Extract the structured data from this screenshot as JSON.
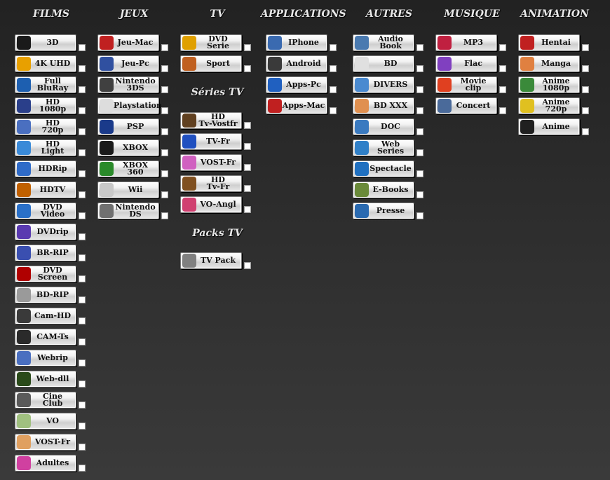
{
  "columns": [
    {
      "header": "FILMS",
      "items": [
        {
          "label": "3D",
          "icon": "3d-icon",
          "color": "#1a1a1a"
        },
        {
          "label": "4K UHD",
          "icon": "4k-icon",
          "color": "#e8a000"
        },
        {
          "label": "Full\nBluRay",
          "icon": "bluray-icon",
          "color": "#1d5fb0"
        },
        {
          "label": "HD\n1080p",
          "icon": "hd-1080p-icon",
          "color": "#2a3f8a"
        },
        {
          "label": "HD\n720p",
          "icon": "hd-720p-icon",
          "color": "#4a6fc0"
        },
        {
          "label": "HD\nLight",
          "icon": "hd-light-icon",
          "color": "#3a8ad8"
        },
        {
          "label": "HDRip",
          "icon": "hdrip-icon",
          "color": "#2f6bc8"
        },
        {
          "label": "HDTV",
          "icon": "hdtv-icon",
          "color": "#c06000"
        },
        {
          "label": "DVD\nVideo",
          "icon": "dvd-video-icon",
          "color": "#2a70c8"
        },
        {
          "label": "DVDrip",
          "icon": "dvdrip-icon",
          "color": "#5a3ab0"
        },
        {
          "label": "BR-RIP",
          "icon": "br-rip-icon",
          "color": "#3a4fb0"
        },
        {
          "label": "DVD\nScreen",
          "icon": "dvd-screen-icon",
          "color": "#b00000"
        },
        {
          "label": "BD-RIP",
          "icon": "bd-rip-icon",
          "color": "#9a9a9a"
        },
        {
          "label": "Cam-HD",
          "icon": "cam-hd-icon",
          "color": "#3a3a3a"
        },
        {
          "label": "CAM-Ts",
          "icon": "cam-ts-icon",
          "color": "#2a2a2a"
        },
        {
          "label": "Webrip",
          "icon": "webrip-icon",
          "color": "#4a6fc0"
        },
        {
          "label": "Web-dll",
          "icon": "web-dll-icon",
          "color": "#2a4a1a"
        },
        {
          "label": "Cine\nClub",
          "icon": "cine-club-icon",
          "color": "#5a5a5a"
        },
        {
          "label": "VO",
          "icon": "vo-icon",
          "color": "#a0c080"
        },
        {
          "label": "VOST-Fr",
          "icon": "vost-fr-icon",
          "color": "#e0a060"
        },
        {
          "label": "Adultes",
          "icon": "adultes-icon",
          "color": "#d040a0"
        }
      ]
    },
    {
      "header": "JEUX",
      "items": [
        {
          "label": "Jeu-Mac",
          "icon": "joystick-icon",
          "color": "#c02020"
        },
        {
          "label": "Jeu-Pc",
          "icon": "joystick-pc-icon",
          "color": "#3050a0"
        },
        {
          "label": "Nintendo\n3DS",
          "icon": "nintendo-3ds-icon",
          "color": "#404040"
        },
        {
          "label": "Playstation",
          "icon": "playstation-icon",
          "color": "#dddddd"
        },
        {
          "label": "PSP",
          "icon": "psp-icon",
          "color": "#1a3a8a"
        },
        {
          "label": "XBOX",
          "icon": "xbox-icon",
          "color": "#1a1a1a"
        },
        {
          "label": "XBOX\n360",
          "icon": "xbox-360-icon",
          "color": "#2a8a2a"
        },
        {
          "label": "Wii",
          "icon": "wii-icon",
          "color": "#c8c8c8"
        },
        {
          "label": "Nintendo\nDS",
          "icon": "nintendo-ds-icon",
          "color": "#707070"
        }
      ]
    },
    {
      "header": "TV",
      "items": [
        {
          "label": "DVD\nSerie",
          "icon": "dvd-serie-icon",
          "color": "#e0a000"
        },
        {
          "label": "Sport",
          "icon": "sport-icon",
          "color": "#c06020"
        }
      ],
      "sections": [
        {
          "header": "Séries TV",
          "items": [
            {
              "label": "HD\nTv-Vostfr",
              "icon": "tv-vostfr-icon",
              "color": "#604020"
            },
            {
              "label": "TV-Fr",
              "icon": "french-flag-icon",
              "color": "#2050c0"
            },
            {
              "label": "VOST-Fr",
              "icon": "vost-fr-bubble-icon",
              "color": "#d060c0"
            },
            {
              "label": "HD\nTv-Fr",
              "icon": "tv-fr-icon",
              "color": "#805020"
            },
            {
              "label": "VO-Angl",
              "icon": "vo-angl-icon",
              "color": "#d04070"
            }
          ]
        },
        {
          "header": "Packs TV",
          "items": [
            {
              "label": "TV Pack",
              "icon": "tv-pack-icon",
              "color": "#808080"
            }
          ]
        }
      ]
    },
    {
      "header": "APPLICATIONS",
      "items": [
        {
          "label": "IPhone",
          "icon": "iphone-icon",
          "color": "#3a6ab0"
        },
        {
          "label": "Android",
          "icon": "android-icon",
          "color": "#3a3a3a"
        },
        {
          "label": "Apps-Pc",
          "icon": "windows-icon",
          "color": "#2060c0"
        },
        {
          "label": "Apps-Mac",
          "icon": "apple-icon",
          "color": "#c02020"
        }
      ]
    },
    {
      "header": "AUTRES",
      "items": [
        {
          "label": "Audio\nBook",
          "icon": "audio-book-icon",
          "color": "#4a7ab0"
        },
        {
          "label": "BD",
          "icon": "bd-comic-icon",
          "color": "#e0e0e0"
        },
        {
          "label": "DIVERS",
          "icon": "divers-icon",
          "color": "#4a8ad0"
        },
        {
          "label": "BD XXX",
          "icon": "bd-xxx-icon",
          "color": "#e09050"
        },
        {
          "label": "DOC",
          "icon": "doc-globe-icon",
          "color": "#3a7ac0"
        },
        {
          "label": "Web\nSeries",
          "icon": "web-series-icon",
          "color": "#3080c8"
        },
        {
          "label": "Spectacle",
          "icon": "spectacle-icon",
          "color": "#2070c0"
        },
        {
          "label": "E-Books",
          "icon": "e-books-icon",
          "color": "#6a8a3a"
        },
        {
          "label": "Presse",
          "icon": "presse-icon",
          "color": "#2a6ab0"
        }
      ]
    },
    {
      "header": "MUSIQUE",
      "items": [
        {
          "label": "MP3",
          "icon": "headphones-icon",
          "color": "#c02040"
        },
        {
          "label": "Flac",
          "icon": "flac-icon",
          "color": "#8040c0"
        },
        {
          "label": "Movie\nclip",
          "icon": "movie-clip-icon",
          "color": "#e04020"
        },
        {
          "label": "Concert",
          "icon": "concert-icon",
          "color": "#4a6a9a"
        }
      ]
    },
    {
      "header": "ANIMATION",
      "items": [
        {
          "label": "Hentai",
          "icon": "hentai-icon",
          "color": "#c02020"
        },
        {
          "label": "Manga",
          "icon": "manga-icon",
          "color": "#e08040"
        },
        {
          "label": "Anime\n1080p",
          "icon": "anime-1080p-icon",
          "color": "#3a8a3a"
        },
        {
          "label": "Anime\n720p",
          "icon": "anime-720p-icon",
          "color": "#e0c020"
        },
        {
          "label": "Anime",
          "icon": "mickey-icon",
          "color": "#202020"
        }
      ]
    }
  ]
}
